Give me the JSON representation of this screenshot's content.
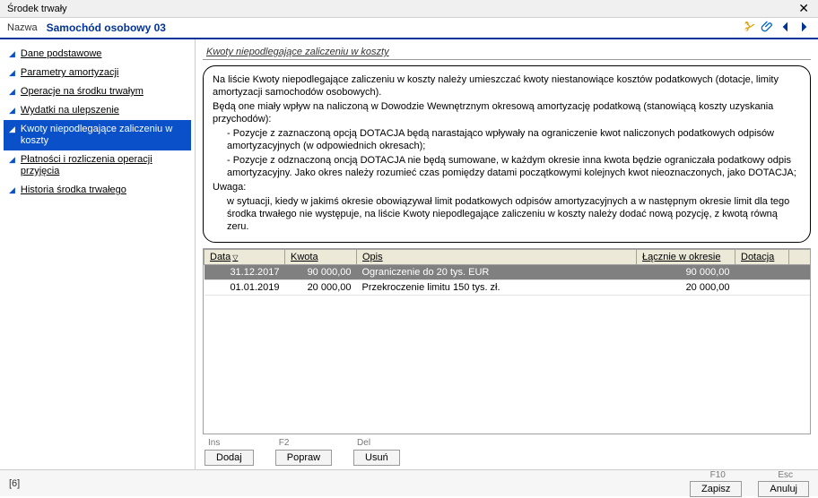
{
  "window": {
    "title": "Środek trwały"
  },
  "header": {
    "label": "Nazwa",
    "value": "Samochód osobowy 03"
  },
  "sidebar": {
    "items": [
      {
        "label": "Dane podstawowe"
      },
      {
        "label": "Parametry amortyzacji"
      },
      {
        "label": "Operacje na środku trwałym"
      },
      {
        "label": "Wydatki na ulepszenie"
      },
      {
        "label": "Kwoty niepodlegające zaliczeniu w koszty",
        "selected": true
      },
      {
        "label": "Płatności i rozliczenia operacji przyjęcia"
      },
      {
        "label": "Historia środka trwałego"
      }
    ]
  },
  "main": {
    "section_title": "Kwoty niepodlegające zaliczeniu w koszty",
    "info": {
      "p1": "Na liście Kwoty niepodlegające zaliczeniu w koszty należy umieszczać kwoty niestanowiące kosztów podatkowych (dotacje, limity amortyzacji samochodów osobowych).",
      "p2": "Będą one miały wpływ na naliczoną w Dowodzie Wewnętrznym okresową amortyzację podatkową (stanowiącą koszty uzyskania przychodów):",
      "b1": "- Pozycje z zaznaczoną opcją DOTACJA będą narastająco wpływały na ograniczenie kwot naliczonych podatkowych odpisów amortyzacyjnych (w odpowiednich okresach);",
      "b2": "- Pozycje z odznaczoną oncją DOTACJA nie będą sumowane, w każdym okresie inna kwota będzie ograniczała podatkowy odpis amortyzacyjny. Jako okres należy rozumieć czas pomiędzy datami początkowymi kolejnych kwot nieoznaczonych, jako DOTACJA;",
      "u_label": "Uwaga:",
      "u_text": "w sytuacji, kiedy w jakimś okresie obowiązywał limit podatkowych odpisów amortyzacyjnych a w następnym okresie limit dla tego środka trwałego nie występuje, na liście Kwoty niepodlegające zaliczeniu w koszty należy dodać nową pozycję, z kwotą równą zeru."
    },
    "columns": {
      "c0": "Data",
      "c1": "Kwota",
      "c2": "Opis",
      "c3": "Łącznie w okresie",
      "c4": "Dotacja"
    },
    "rows": [
      {
        "date": "31.12.2017",
        "amount": "90 000,00",
        "desc": "Ograniczenie do 20 tys. EUR",
        "total": "90 000,00",
        "donation": ""
      },
      {
        "date": "01.01.2019",
        "amount": "20 000,00",
        "desc": "Przekroczenie limitu 150 tys. zł.",
        "total": "20 000,00",
        "donation": ""
      }
    ],
    "actions": {
      "ins_key": "Ins",
      "ins_btn": "Dodaj",
      "f2_key": "F2",
      "f2_btn": "Popraw",
      "del_key": "Del",
      "del_btn": "Usuń"
    }
  },
  "footer": {
    "left": "[6]",
    "save_key": "F10",
    "save_btn": "Zapisz",
    "cancel_key": "Esc",
    "cancel_btn": "Anuluj"
  }
}
